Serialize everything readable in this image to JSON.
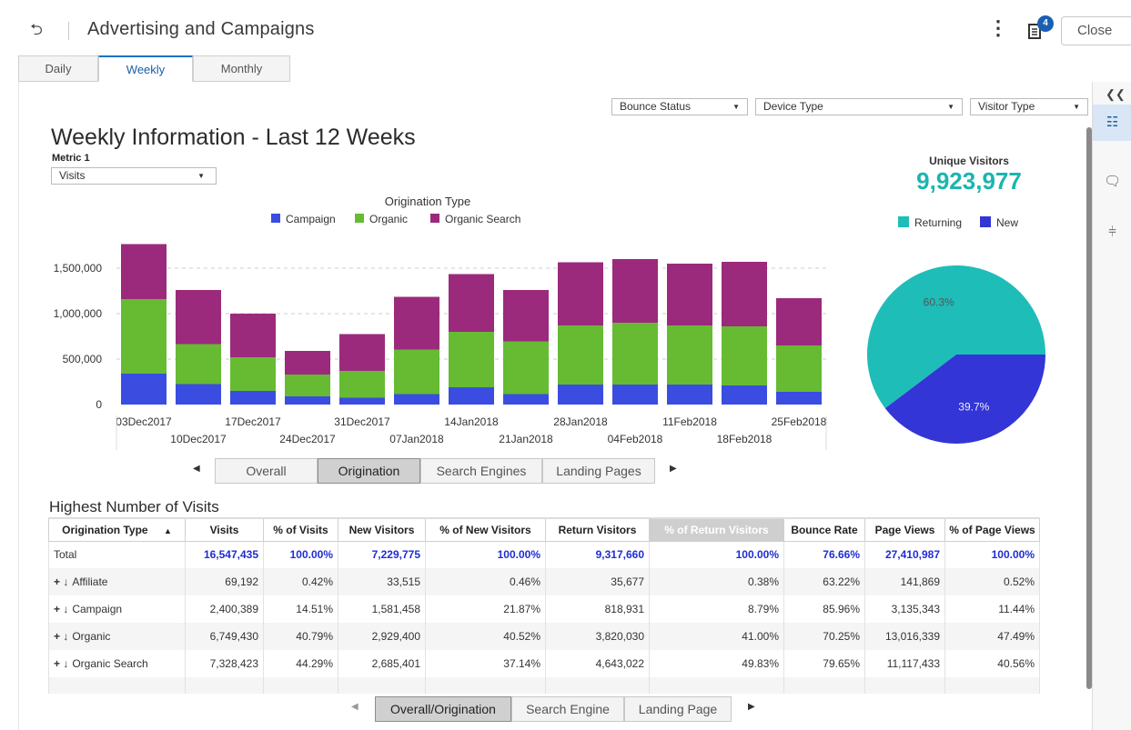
{
  "header": {
    "back_icon": "back-arrow-icon",
    "title": "Advertising and Campaigns",
    "more_icon": "vertical-ellipsis-icon",
    "notes_badge": "4",
    "close_label": "Close"
  },
  "tabs": [
    {
      "label": "Daily"
    },
    {
      "label": "Weekly"
    },
    {
      "label": "Monthly"
    }
  ],
  "filters": [
    {
      "label": "Bounce Status"
    },
    {
      "label": "Device Type"
    },
    {
      "label": "Visitor Type"
    }
  ],
  "report": {
    "title": "Weekly Information - Last 12 Weeks",
    "metric_label": "Metric 1",
    "metric_value": "Visits"
  },
  "chart_pager": {
    "buttons": [
      "Overall",
      "Origination",
      "Search Engines",
      "Landing Pages"
    ],
    "active": "Origination"
  },
  "unique_visitors": {
    "label": "Unique Visitors",
    "value": "9,923,977"
  },
  "chart_data": [
    {
      "type": "bar",
      "stacked": true,
      "title": "Origination Type",
      "legend_title": "Origination Type",
      "legend_position": "top",
      "categories": [
        "03Dec2017",
        "10Dec2017",
        "17Dec2017",
        "24Dec2017",
        "31Dec2017",
        "07Jan2018",
        "14Jan2018",
        "21Jan2018",
        "28Jan2018",
        "04Feb2018",
        "11Feb2018",
        "18Feb2018",
        "25Feb2018"
      ],
      "series": [
        {
          "name": "Campaign",
          "color": "#3a4de0",
          "values": [
            340000,
            225000,
            150000,
            90000,
            75000,
            115000,
            190000,
            115000,
            220000,
            220000,
            220000,
            210000,
            140000
          ]
        },
        {
          "name": "Organic",
          "color": "#66bb33",
          "values": [
            820000,
            440000,
            370000,
            240000,
            295000,
            490000,
            610000,
            580000,
            650000,
            680000,
            650000,
            650000,
            510000
          ]
        },
        {
          "name": "Organic Search",
          "color": "#9b2a7c",
          "values": [
            605000,
            595000,
            480000,
            260000,
            405000,
            580000,
            635000,
            565000,
            695000,
            700000,
            680000,
            710000,
            520000
          ]
        }
      ],
      "yticks": [
        "0",
        "500,000",
        "1,000,000",
        "1,500,000"
      ],
      "ylim": [
        0,
        1800000
      ],
      "grid": true
    },
    {
      "type": "pie",
      "legend_position": "top",
      "slices": [
        {
          "name": "Returning",
          "value": 60.3,
          "label": "60.3%",
          "color": "#1fbdb8"
        },
        {
          "name": "New",
          "value": 39.7,
          "label": "39.7%",
          "color": "#3335d6"
        }
      ]
    }
  ],
  "table": {
    "title": "Highest Number of Visits",
    "columns": [
      "Origination Type",
      "Visits",
      "% of Visits",
      "New Visitors",
      "% of New Visitors",
      "Return Visitors",
      "% of Return Visitors",
      "Bounce Rate",
      "Page Views",
      "% of Page Views"
    ],
    "sort_icon": "sort-ascending-icon",
    "selected_column": "% of Return Visitors",
    "rows": [
      {
        "name": "Total",
        "expandable": false,
        "cells": [
          "16,547,435",
          "100.00%",
          "7,229,775",
          "100.00%",
          "9,317,660",
          "100.00%",
          "76.66%",
          "27,410,987",
          "100.00%"
        ]
      },
      {
        "name": "Affiliate",
        "expandable": true,
        "cells": [
          "69,192",
          "0.42%",
          "33,515",
          "0.46%",
          "35,677",
          "0.38%",
          "63.22%",
          "141,869",
          "0.52%"
        ]
      },
      {
        "name": "Campaign",
        "expandable": true,
        "cells": [
          "2,400,389",
          "14.51%",
          "1,581,458",
          "21.87%",
          "818,931",
          "8.79%",
          "85.96%",
          "3,135,343",
          "11.44%"
        ]
      },
      {
        "name": "Organic",
        "expandable": true,
        "cells": [
          "6,749,430",
          "40.79%",
          "2,929,400",
          "40.52%",
          "3,820,030",
          "41.00%",
          "70.25%",
          "13,016,339",
          "47.49%"
        ]
      },
      {
        "name": "Organic Search",
        "expandable": true,
        "cells": [
          "7,328,423",
          "44.29%",
          "2,685,401",
          "37.14%",
          "4,643,022",
          "49.83%",
          "79.65%",
          "11,117,433",
          "40.56%"
        ]
      }
    ]
  },
  "table_pager": {
    "buttons": [
      "Overall/Origination",
      "Search Engine",
      "Landing Page"
    ],
    "active": "Overall/Origination"
  }
}
